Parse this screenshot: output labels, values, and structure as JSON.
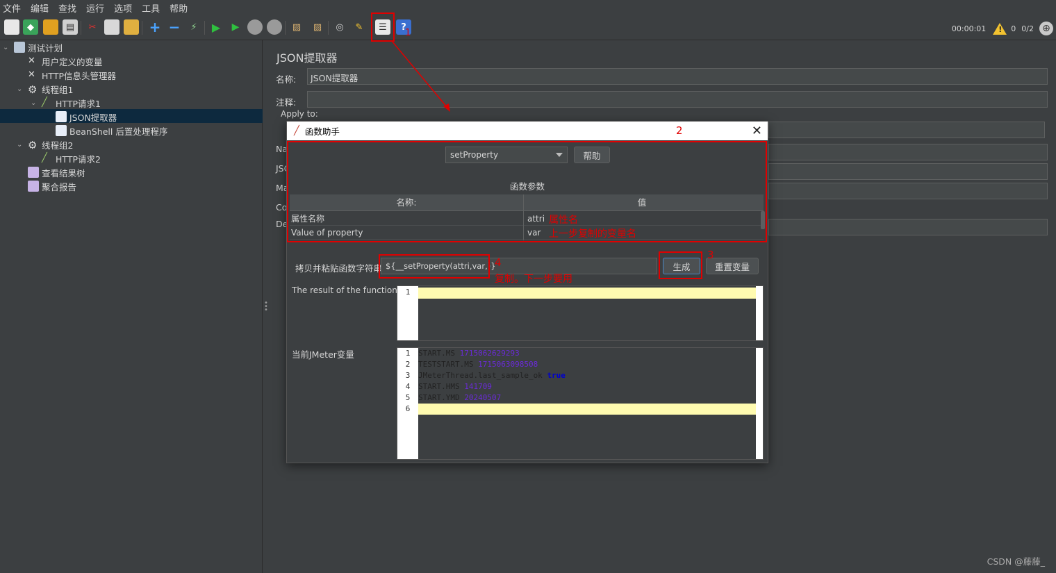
{
  "menu": [
    "文件",
    "编辑",
    "查找",
    "运行",
    "选项",
    "工具",
    "帮助"
  ],
  "toolbar": {
    "timer": "00:00:01",
    "warnings": "0",
    "threads": "0/2"
  },
  "tree": {
    "root": "测试计划",
    "user_vars": "用户定义的变量",
    "http_header": "HTTP信息头管理器",
    "group1": "线程组1",
    "http1": "HTTP请求1",
    "json_extractor": "JSON提取器",
    "beanshell": "BeanShell 后置处理程序",
    "group2": "线程组2",
    "http2": "HTTP请求2",
    "results_tree": "查看结果树",
    "aggregate": "聚合报告"
  },
  "panel": {
    "title": "JSON提取器",
    "name_label": "名称:",
    "name_value": "JSON提取器",
    "comment_label": "注释:",
    "apply_to": "Apply to:",
    "label_na": "Na",
    "label_jsc": "JSC",
    "label_ma": "Ma",
    "label_co": "Co",
    "label_de": "De"
  },
  "dialog": {
    "title": "函数助手",
    "function": "setProperty",
    "help_button": "帮助",
    "params_label": "函数参数",
    "col_name": "名称:",
    "col_value": "值",
    "rows": [
      {
        "name": "属性名称",
        "value": "attri"
      },
      {
        "name": "Value of property",
        "value": "var"
      }
    ],
    "copy_label": "拷贝并粘贴函数字符串",
    "function_string": "${__setProperty(attri,var,)}",
    "generate_button": "生成",
    "reset_button": "重置变量",
    "result_label": "The result of the function is",
    "vars_label": "当前JMeter变量",
    "result_lines": [
      "1"
    ],
    "vars": [
      {
        "ln": "1",
        "key": "START.MS ",
        "val": "1715062629293"
      },
      {
        "ln": "2",
        "key": "TESTSTART.MS ",
        "val": "1715063098508"
      },
      {
        "ln": "3",
        "key": "JMeterThread.last_sample_ok ",
        "val": "true"
      },
      {
        "ln": "4",
        "key": "START.HMS ",
        "val": "141709"
      },
      {
        "ln": "5",
        "key": "START.YMD ",
        "val": "20240507"
      },
      {
        "ln": "6",
        "key": "",
        "val": ""
      }
    ]
  },
  "annotations": {
    "n1": "1",
    "n2": "2",
    "n3": "3",
    "n4": "4",
    "attr_note": "属性名",
    "var_note": "上一步复制的变量名",
    "copy_note": "复制。下一步要用"
  },
  "watermark": "CSDN @藤藤_",
  "colors": {
    "annotation": "#e00000",
    "selection": "#0d293e",
    "highlight": "#fffbb0"
  }
}
